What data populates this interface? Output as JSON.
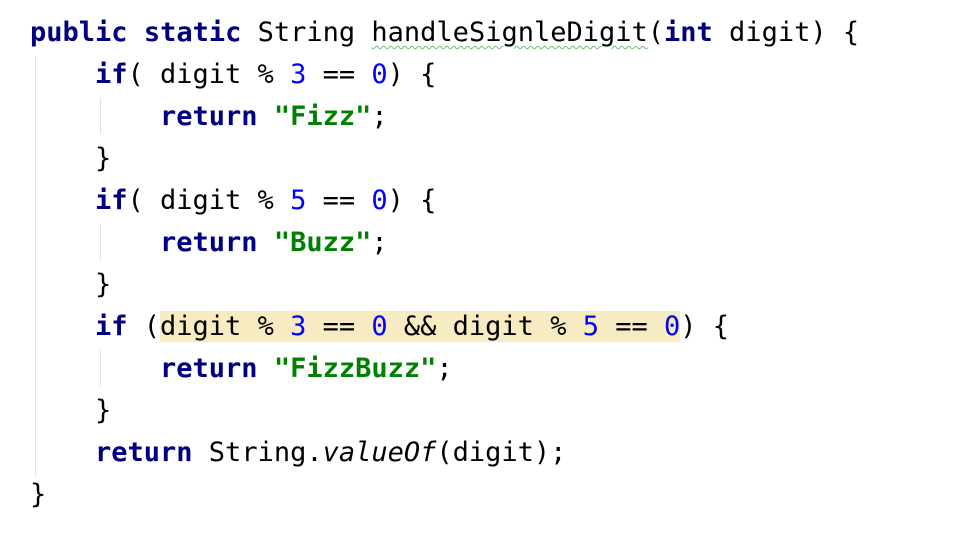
{
  "code": {
    "lines": [
      {
        "indent": 0,
        "tokens": [
          {
            "t": "public",
            "c": "kw"
          },
          {
            "t": " "
          },
          {
            "t": "static",
            "c": "kw"
          },
          {
            "t": " String "
          },
          {
            "t": "handleSignleDigit",
            "c": "warn"
          },
          {
            "t": "("
          },
          {
            "t": "int",
            "c": "kw"
          },
          {
            "t": " digit) {"
          }
        ]
      },
      {
        "indent": 1,
        "tokens": [
          {
            "t": "if",
            "c": "kw"
          },
          {
            "t": "( digit % "
          },
          {
            "t": "3",
            "c": "num"
          },
          {
            "t": " == "
          },
          {
            "t": "0",
            "c": "num"
          },
          {
            "t": ") {"
          }
        ]
      },
      {
        "indent": 2,
        "tokens": [
          {
            "t": "return",
            "c": "kw"
          },
          {
            "t": " "
          },
          {
            "t": "\"Fizz\"",
            "c": "str"
          },
          {
            "t": ";"
          }
        ]
      },
      {
        "indent": 1,
        "tokens": [
          {
            "t": "}"
          }
        ]
      },
      {
        "indent": 1,
        "tokens": [
          {
            "t": "if",
            "c": "kw"
          },
          {
            "t": "( digit % "
          },
          {
            "t": "5",
            "c": "num"
          },
          {
            "t": " == "
          },
          {
            "t": "0",
            "c": "num"
          },
          {
            "t": ") {"
          }
        ]
      },
      {
        "indent": 2,
        "tokens": [
          {
            "t": "return",
            "c": "kw"
          },
          {
            "t": " "
          },
          {
            "t": "\"Buzz\"",
            "c": "str"
          },
          {
            "t": ";"
          }
        ]
      },
      {
        "indent": 1,
        "tokens": [
          {
            "t": "}"
          }
        ]
      },
      {
        "indent": 1,
        "tokens": [
          {
            "t": "if",
            "c": "kw"
          },
          {
            "t": " ("
          },
          {
            "t": "digit % ",
            "h": true
          },
          {
            "t": "3",
            "c": "num",
            "h": true
          },
          {
            "t": " == ",
            "h": true
          },
          {
            "t": "0",
            "c": "num",
            "h": true
          },
          {
            "t": " && digit % ",
            "h": true
          },
          {
            "t": "5",
            "c": "num",
            "h": true
          },
          {
            "t": " == ",
            "h": true
          },
          {
            "t": "0",
            "c": "num",
            "h": true
          },
          {
            "t": ") {"
          }
        ]
      },
      {
        "indent": 2,
        "tokens": [
          {
            "t": "return",
            "c": "kw"
          },
          {
            "t": " "
          },
          {
            "t": "\"FizzBuzz\"",
            "c": "str"
          },
          {
            "t": ";"
          }
        ]
      },
      {
        "indent": 1,
        "tokens": [
          {
            "t": "}"
          }
        ]
      },
      {
        "indent": 1,
        "tokens": [
          {
            "t": "return",
            "c": "kw"
          },
          {
            "t": " String."
          },
          {
            "t": "valueOf",
            "c": "method"
          },
          {
            "t": "(digit);"
          }
        ]
      },
      {
        "indent": 0,
        "tokens": [
          {
            "t": "}"
          }
        ]
      }
    ]
  },
  "colors": {
    "keyword": "#000080",
    "number": "#0000ff",
    "string": "#008000",
    "highlight": "#f7ebc1",
    "warning_underline": "#6dbb6d"
  }
}
